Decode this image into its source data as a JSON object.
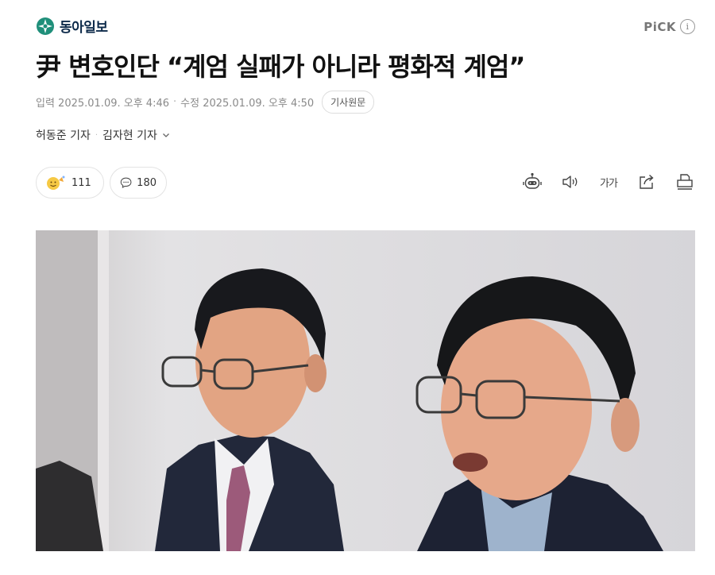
{
  "header": {
    "logo_text": "동아일보",
    "pick_label": "PiCK",
    "info_symbol": "i"
  },
  "article": {
    "headline": "尹 변호인단 “계엄 실패가 아니라 평화적 계엄”",
    "published": "입력 2025.01.09. 오후 4:46",
    "modified": "수정 2025.01.09. 오후 4:50",
    "separator": "·",
    "original_button": "기사원문",
    "reporters": [
      "허동준 기자",
      "김자현 기자"
    ]
  },
  "actions": {
    "reaction_count": "111",
    "comment_count": "180",
    "font_size_label": "가가",
    "tools": [
      "summary-bot-icon",
      "speaker-icon",
      "font-size-icon",
      "share-icon",
      "print-icon"
    ]
  },
  "colors": {
    "logo_accent": "#1f8f7a",
    "logo_text": "#0d2a4a",
    "meta_text": "#8a8a8a"
  }
}
